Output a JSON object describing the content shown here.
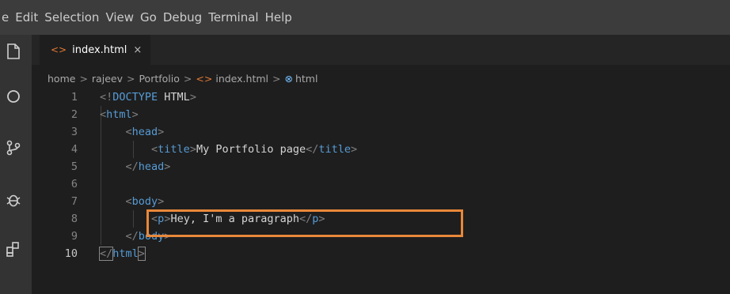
{
  "menu": [
    "e",
    "Edit",
    "Selection",
    "View",
    "Go",
    "Debug",
    "Terminal",
    "Help"
  ],
  "activity_icons": [
    "files-icon",
    "search-icon",
    "source-control-icon",
    "debug-icon",
    "extensions-icon"
  ],
  "tab": {
    "label": "index.html",
    "icon": "html-file-icon",
    "close": "×"
  },
  "breadcrumb": {
    "items": [
      "home",
      "rajeev",
      "Portfolio",
      "index.html",
      "html"
    ],
    "separator": ">"
  },
  "editor": {
    "lines": [
      {
        "n": "1",
        "parts": [
          [
            "punc",
            "<!"
          ],
          [
            "tag",
            "DOCTYPE"
          ],
          [
            "plain",
            " HTML"
          ],
          [
            "punc",
            ">"
          ]
        ]
      },
      {
        "n": "2",
        "parts": [
          [
            "punc",
            "<"
          ],
          [
            "tag",
            "html"
          ],
          [
            "punc",
            ">"
          ]
        ]
      },
      {
        "n": "3",
        "parts": [
          [
            "plain",
            "    "
          ],
          [
            "punc",
            "<"
          ],
          [
            "tag",
            "head"
          ],
          [
            "punc",
            ">"
          ]
        ]
      },
      {
        "n": "4",
        "parts": [
          [
            "plain",
            "        "
          ],
          [
            "punc",
            "<"
          ],
          [
            "tag",
            "title"
          ],
          [
            "punc",
            ">"
          ],
          [
            "plain",
            "My Portfolio page"
          ],
          [
            "punc",
            "</"
          ],
          [
            "tag",
            "title"
          ],
          [
            "punc",
            ">"
          ]
        ]
      },
      {
        "n": "5",
        "parts": [
          [
            "plain",
            "    "
          ],
          [
            "punc",
            "</"
          ],
          [
            "tag",
            "head"
          ],
          [
            "punc",
            ">"
          ]
        ]
      },
      {
        "n": "6",
        "parts": []
      },
      {
        "n": "7",
        "parts": [
          [
            "plain",
            "    "
          ],
          [
            "punc",
            "<"
          ],
          [
            "tag",
            "body"
          ],
          [
            "punc",
            ">"
          ]
        ]
      },
      {
        "n": "8",
        "parts": [
          [
            "plain",
            "        "
          ],
          [
            "punc",
            "<"
          ],
          [
            "tag",
            "p"
          ],
          [
            "punc",
            ">"
          ],
          [
            "plain",
            "Hey, I'm a paragraph"
          ],
          [
            "punc",
            "</"
          ],
          [
            "tag",
            "p"
          ],
          [
            "punc",
            ">"
          ]
        ]
      },
      {
        "n": "9",
        "parts": [
          [
            "plain",
            "    "
          ],
          [
            "punc",
            "</"
          ],
          [
            "tag",
            "body"
          ],
          [
            "punc",
            ">"
          ]
        ]
      },
      {
        "n": "10",
        "parts": [
          [
            "punc",
            "</"
          ],
          [
            "tag",
            "html"
          ],
          [
            "punc",
            ">"
          ]
        ],
        "active": true
      }
    ]
  },
  "colors": {
    "highlight_box": "#e8883a",
    "tag": "#569cd6",
    "bracket": "#808080",
    "text": "#d4d4d4"
  }
}
